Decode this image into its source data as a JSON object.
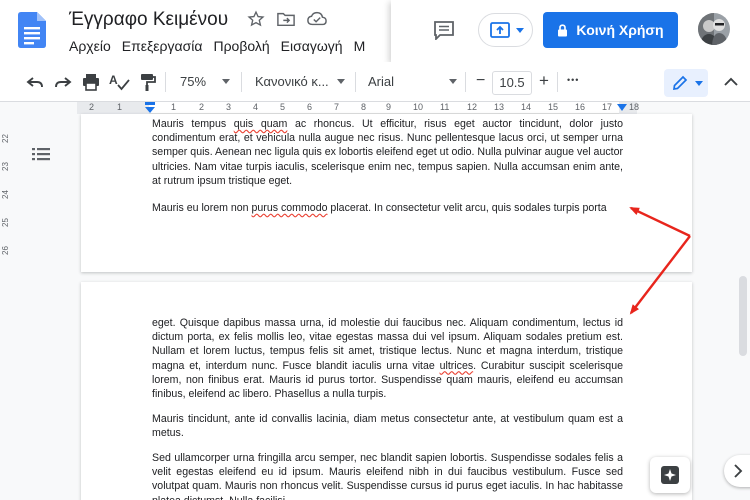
{
  "header": {
    "title": "Έγγραφο Κειμένου",
    "menu": [
      "Αρχείο",
      "Επεξεργασία",
      "Προβολή",
      "Εισαγωγή",
      "Μ"
    ],
    "share_label": "Κοινή Χρήση"
  },
  "toolbar": {
    "zoom": "75%",
    "style": "Κανονικό κ...",
    "font": "Arial",
    "font_size": "10.5",
    "minus": "−",
    "plus": "+",
    "more": "•••"
  },
  "ruler": {
    "numbers": [
      "2",
      "1",
      "1",
      "2",
      "3",
      "4",
      "5",
      "6",
      "7",
      "8",
      "9",
      "10",
      "11",
      "12",
      "13",
      "14",
      "15",
      "16",
      "17",
      "18"
    ],
    "vertical_numbers": [
      "22",
      "23",
      "24",
      "25",
      "26"
    ]
  },
  "page1": {
    "paragraphs": [
      [
        {
          "t": "Mauris tempus "
        },
        {
          "t": "quis quam",
          "sq": true
        },
        {
          "t": " ac rhoncus. Ut efficitur, risus eget auctor tincidunt, dolor justo condimentum erat, et vehicula nulla augue nec risus. Nunc pellentesque lacus orci, ut semper urna semper quis. Aenean nec ligula quis ex lobortis eleifend eget ut odio. Nulla pulvinar augue vel auctor ultricies. Nam vitae turpis iaculis, scelerisque enim nec, tempus sapien. Nulla accumsan enim ante, at rutrum ipsum tristique eget."
        }
      ],
      [
        {
          "t": "Mauris eu lorem non "
        },
        {
          "t": "purus commodo",
          "sq": true
        },
        {
          "t": " placerat. In consectetur velit arcu, quis sodales turpis porta"
        }
      ]
    ]
  },
  "page2": {
    "paragraphs": [
      [
        {
          "t": "eget. Quisque dapibus massa urna, id molestie dui faucibus nec. Aliquam condimentum, lectus id dictum porta, ex felis mollis leo, vitae egestas massa dui vel ipsum. Aliquam sodales pretium est. Nullam et lorem luctus, tempus felis sit amet, tristique lectus. Nunc et magna interdum, tristique magna et, interdum nunc. Fusce blandit iaculis urna vitae "
        },
        {
          "t": "ultrices",
          "sq": true
        },
        {
          "t": ". Curabitur suscipit scelerisque lorem, non finibus erat. Mauris id purus tortor. Suspendisse quam mauris, eleifend eu accumsan finibus, eleifend ac libero. Phasellus a nulla turpis."
        }
      ],
      [
        {
          "t": "Mauris tincidunt, ante id convallis lacinia, diam metus consectetur ante, at vestibulum quam est a metus."
        }
      ],
      [
        {
          "t": "Sed ullamcorper urna fringilla arcu semper, nec blandit sapien lobortis. Suspendisse sodales felis a velit egestas eleifend eu id ipsum. Mauris eleifend nibh in dui faucibus vestibulum. Fusce sed volutpat quam. Mauris non rhoncus velit. Suspendisse cursus id purus eget iaculis. In hac habitasse platea dictumst. Nulla facilisi."
        }
      ]
    ]
  },
  "colors": {
    "brand_blue": "#1a73e8",
    "annotation_red": "#e8251c"
  }
}
